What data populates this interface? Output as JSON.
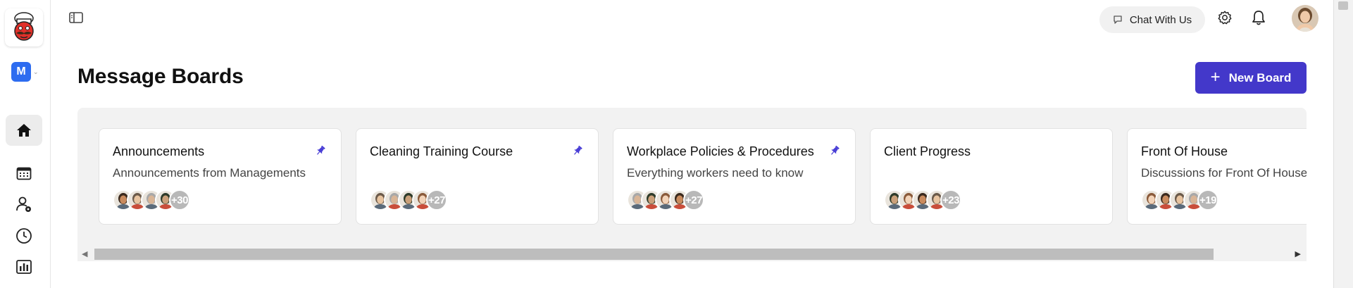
{
  "sidebar": {
    "workspace_initial": "M",
    "nav": [
      {
        "name": "home-icon",
        "active": true
      },
      {
        "name": "calendar-icon",
        "active": false
      },
      {
        "name": "user-settings-icon",
        "active": false
      },
      {
        "name": "clock-icon",
        "active": false
      },
      {
        "name": "bar-chart-icon",
        "active": false
      }
    ]
  },
  "header": {
    "chat_label": "Chat With Us",
    "icons": [
      "sidebar-toggle-icon",
      "chat-bubble-icon",
      "gear-icon",
      "bell-icon"
    ]
  },
  "page": {
    "title": "Message Boards",
    "new_board_label": "New Board",
    "new_board_icon": "+"
  },
  "boards": [
    {
      "title": "Announcements",
      "description": "Announcements from Managements",
      "pinned": true,
      "more": "+30"
    },
    {
      "title": "Cleaning Training Course",
      "description": "",
      "pinned": true,
      "more": "+27"
    },
    {
      "title": "Workplace Policies & Procedures",
      "description": "Everything workers need to know",
      "pinned": true,
      "more": "+27"
    },
    {
      "title": "Client Progress",
      "description": "",
      "pinned": false,
      "more": "+23"
    },
    {
      "title": "Front Of House",
      "description": "Discussions for Front Of House",
      "pinned": false,
      "more": "+19"
    }
  ],
  "colors": {
    "accent": "#4338ca",
    "workspace_badge": "#2d6cf0",
    "pin": "#4a3fd6"
  },
  "scroll": {
    "left_arrow": "◀",
    "right_arrow": "▶"
  }
}
